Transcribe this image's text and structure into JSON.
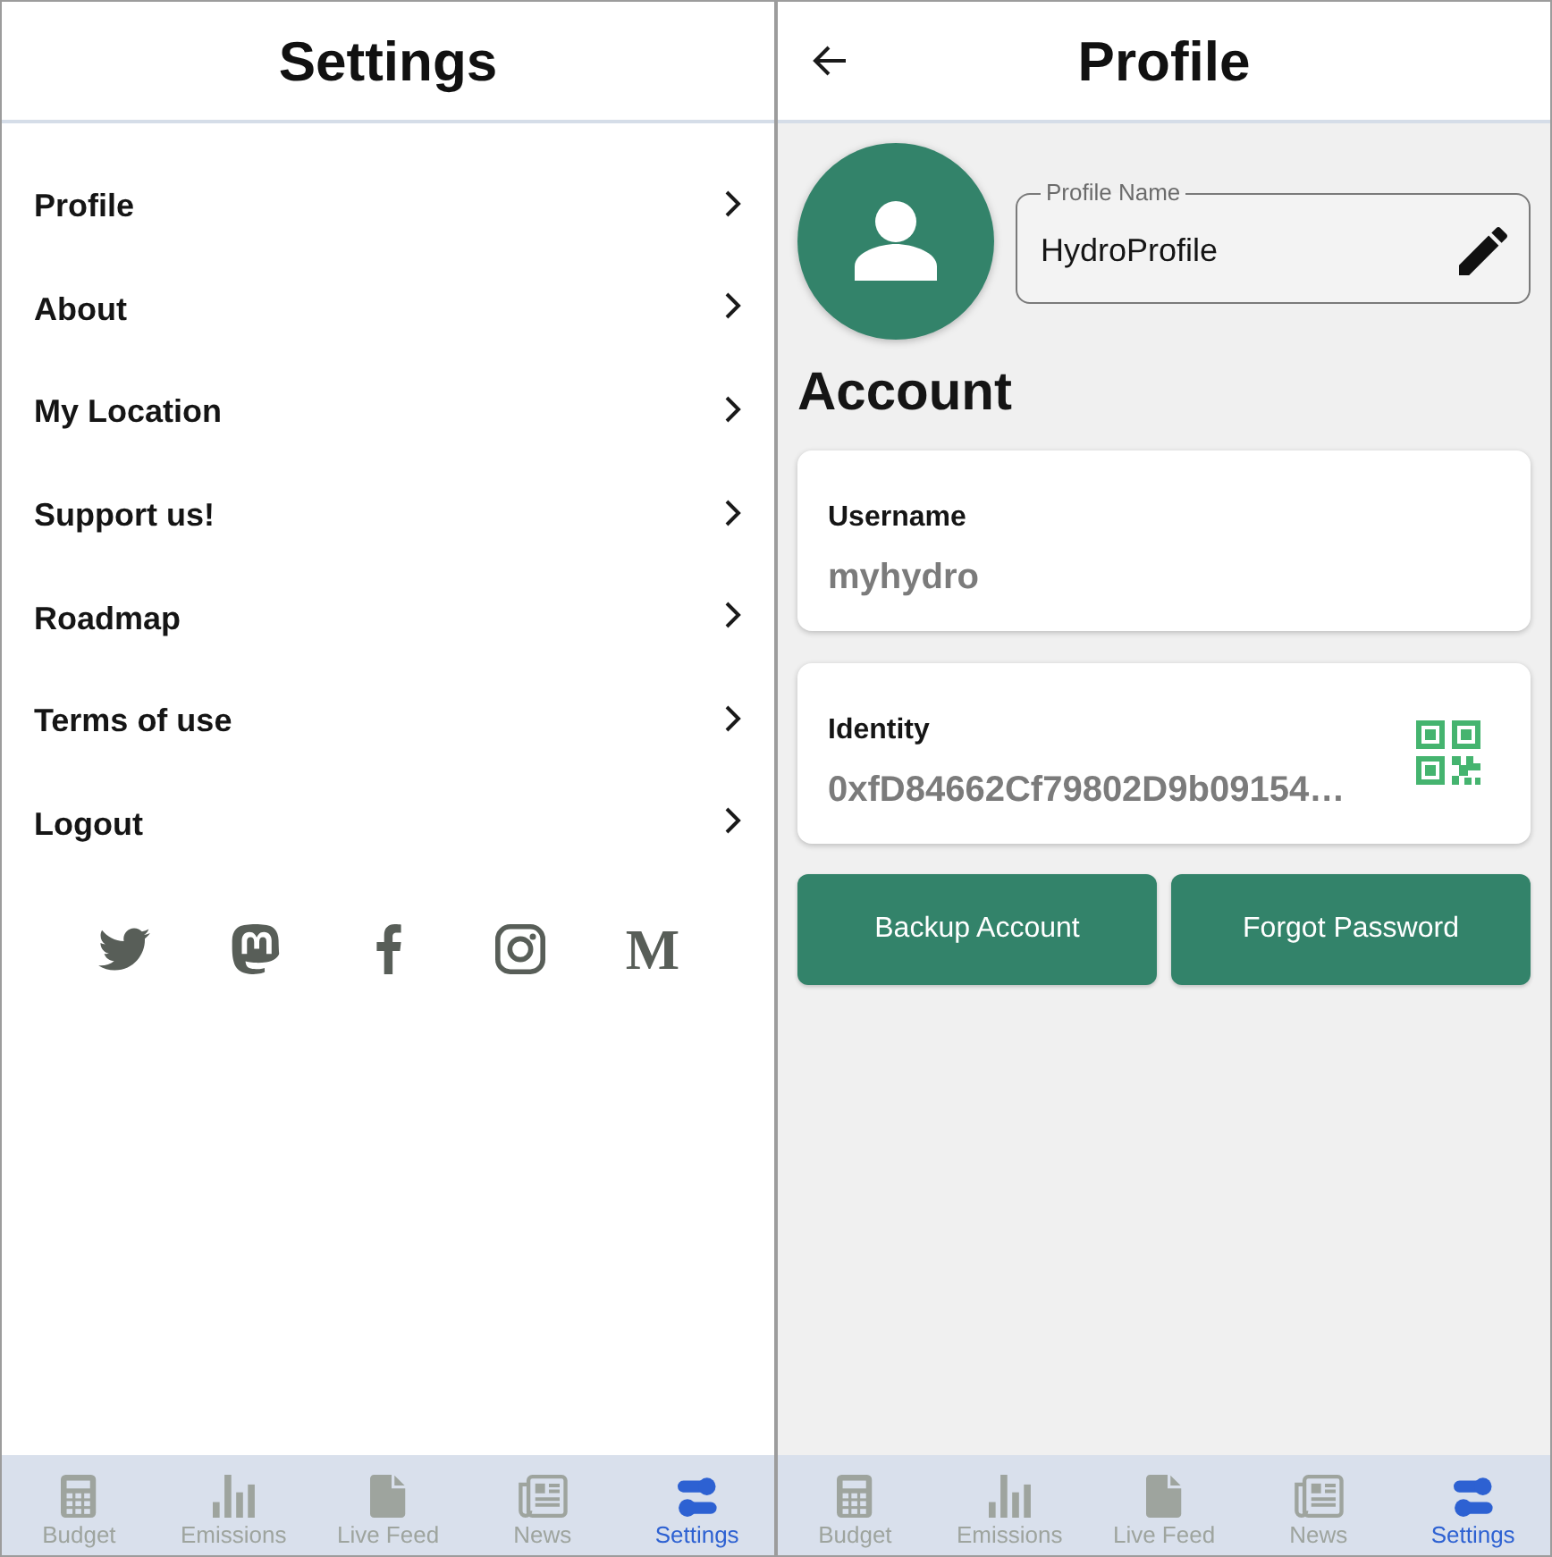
{
  "settings_screen": {
    "title": "Settings",
    "menu_items": [
      {
        "label": "Profile"
      },
      {
        "label": "About"
      },
      {
        "label": "My Location"
      },
      {
        "label": "Support us!"
      },
      {
        "label": "Roadmap"
      },
      {
        "label": "Terms of use"
      },
      {
        "label": "Logout"
      }
    ],
    "social_links": [
      {
        "kind": "icon"
      },
      {
        "kind": "icon"
      },
      {
        "kind": "icon"
      },
      {
        "kind": "icon"
      },
      {
        "kind": "glyph",
        "text": "M"
      }
    ],
    "bottom_nav": [
      {
        "label": "Budget",
        "selected": false
      },
      {
        "label": "Emissions",
        "selected": false
      },
      {
        "label": "Live Feed",
        "selected": false
      },
      {
        "label": "News",
        "selected": false
      },
      {
        "label": "Settings",
        "selected": true
      }
    ]
  },
  "profile_screen": {
    "title": "Profile",
    "profile_name_field": {
      "label": "Profile Name",
      "value": "HydroProfile"
    },
    "section_title": "Account",
    "cards": [
      {
        "kind": "plain",
        "label": "Username",
        "value": "myhydro"
      },
      {
        "kind": "shareable",
        "label": "Identity",
        "value": "0xfD84662Cf79802D9b09154…"
      }
    ],
    "buttons": [
      "Backup Account",
      "Forgot Password"
    ],
    "bottom_nav": [
      {
        "label": "Budget",
        "selected": false
      },
      {
        "label": "Emissions",
        "selected": false
      },
      {
        "label": "Live Feed",
        "selected": false
      },
      {
        "label": "News",
        "selected": false
      },
      {
        "label": "Settings",
        "selected": true
      }
    ]
  }
}
